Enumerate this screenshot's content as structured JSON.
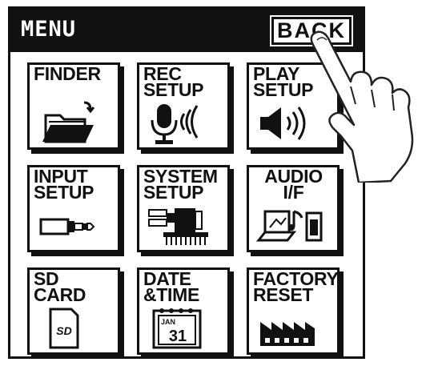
{
  "header": {
    "title": "MENU",
    "back_label": "BACK"
  },
  "tiles": [
    {
      "label": "FINDER",
      "icon": "folder-open-icon"
    },
    {
      "label": "REC\nSETUP",
      "icon": "microphone-icon"
    },
    {
      "label": "PLAY\nSETUP",
      "icon": "speaker-icon"
    },
    {
      "label": "INPUT\nSETUP",
      "icon": "input-jack-icon"
    },
    {
      "label": "SYSTEM\nSETUP",
      "icon": "system-chip-icon"
    },
    {
      "label": "AUDIO\nI/F",
      "icon": "computer-music-icon"
    },
    {
      "label": "SD\nCARD",
      "icon": "sd-card-icon"
    },
    {
      "label": "DATE\n&TIME",
      "icon": "calendar-icon",
      "calendar_month": "JAN",
      "calendar_day": "31"
    },
    {
      "label": "FACTORY\nRESET",
      "icon": "factory-icon"
    }
  ]
}
